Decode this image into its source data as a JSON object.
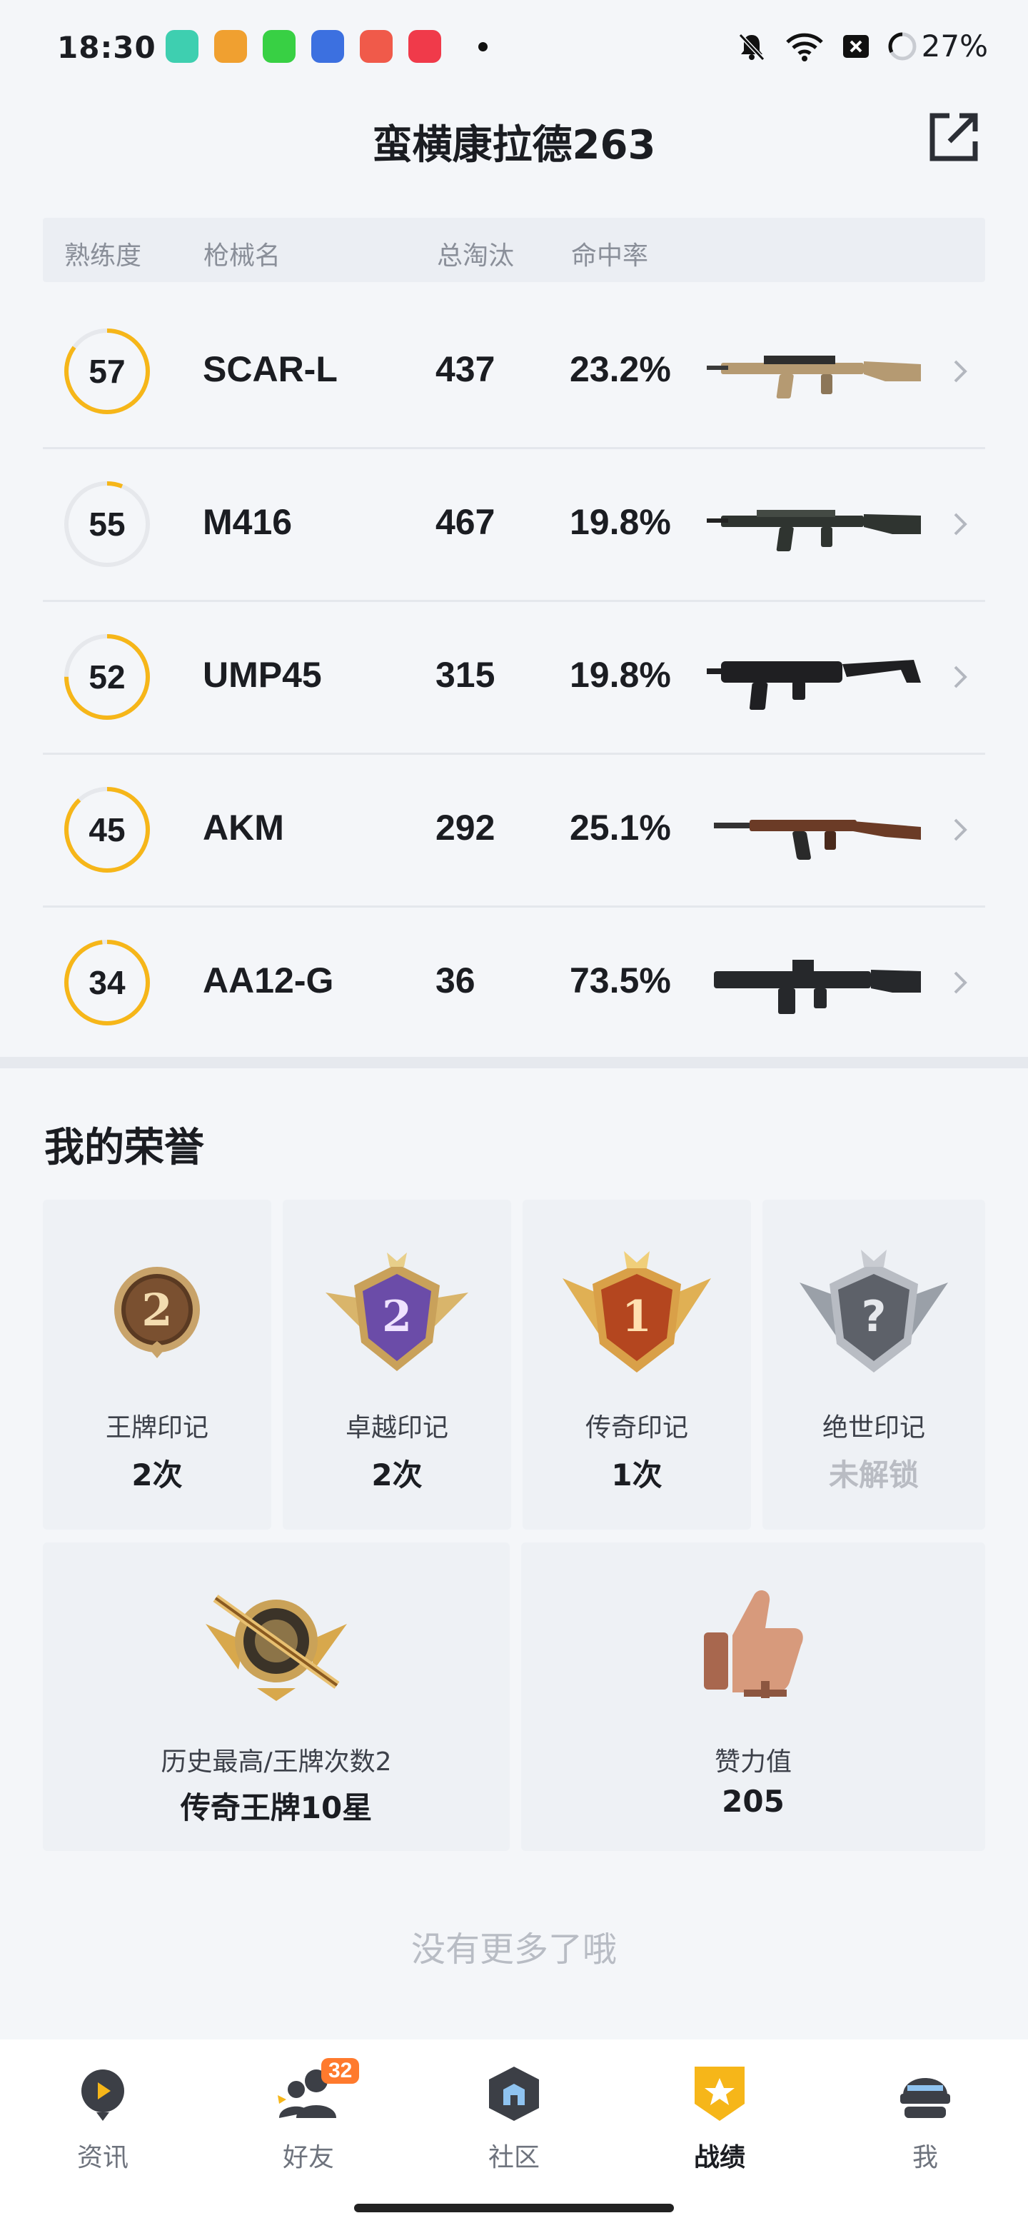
{
  "status_bar": {
    "time": "18:30",
    "battery": "27%",
    "icons": [
      "bell-off-icon",
      "wifi-icon",
      "sim-x-icon",
      "battery-icon"
    ]
  },
  "header": {
    "title": "蛮横康拉德263",
    "share_icon": "share-icon"
  },
  "weapons": {
    "columns": [
      "熟练度",
      "枪械名",
      "总淘汰",
      "命中率"
    ],
    "rows": [
      {
        "proficiency": "57",
        "name": "SCAR-L",
        "kills": "437",
        "hit_rate": "23.2%",
        "ring_fraction": 0.85
      },
      {
        "proficiency": "55",
        "name": "M416",
        "kills": "467",
        "hit_rate": "19.8%",
        "ring_fraction": 0.06
      },
      {
        "proficiency": "52",
        "name": "UMP45",
        "kills": "315",
        "hit_rate": "19.8%",
        "ring_fraction": 0.75
      },
      {
        "proficiency": "45",
        "name": "AKM",
        "kills": "292",
        "hit_rate": "25.1%",
        "ring_fraction": 0.88
      },
      {
        "proficiency": "34",
        "name": "AA12-G",
        "kills": "36",
        "hit_rate": "73.5%",
        "ring_fraction": 0.98
      }
    ]
  },
  "honors": {
    "title": "我的荣誉",
    "cards": [
      {
        "label": "王牌印记",
        "value": "2次"
      },
      {
        "label": "卓越印记",
        "value": "2次"
      },
      {
        "label": "传奇印记",
        "value": "1次"
      },
      {
        "label": "绝世印记",
        "value": "未解锁"
      }
    ],
    "wide_cards": [
      {
        "label": "历史最高/王牌次数2",
        "value": "传奇王牌10星"
      },
      {
        "label": "赞力值",
        "value": "205"
      }
    ]
  },
  "footer_note": "没有更多了哦",
  "nav": {
    "items": [
      {
        "label": "资讯",
        "icon": "news-icon"
      },
      {
        "label": "好友",
        "icon": "friends-icon",
        "badge": "32"
      },
      {
        "label": "社区",
        "icon": "community-icon"
      },
      {
        "label": "战绩",
        "icon": "record-icon",
        "active": true
      },
      {
        "label": "我",
        "icon": "profile-icon"
      }
    ]
  },
  "colors": {
    "accent": "#f6b619",
    "ring_track": "#e6e8ec",
    "badge": "#ff7a2d"
  }
}
